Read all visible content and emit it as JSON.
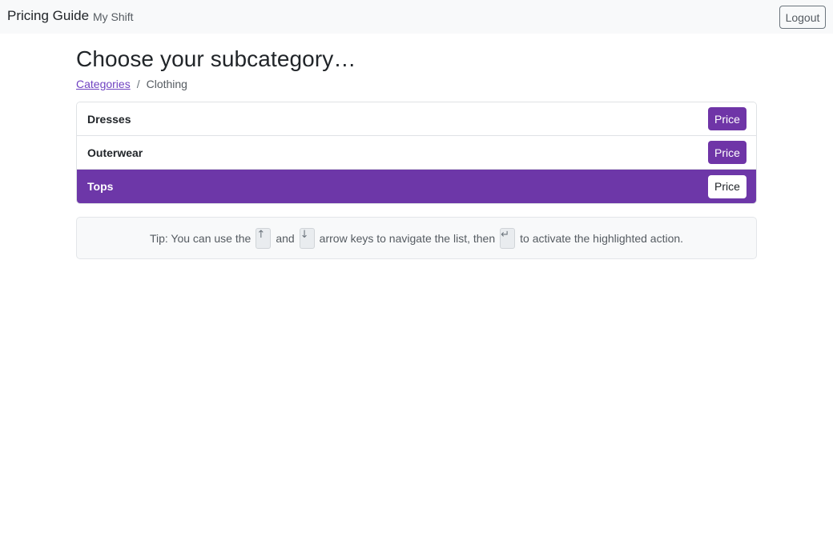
{
  "navbar": {
    "brand": "Pricing Guide",
    "links": [
      "My Shift"
    ],
    "logout_label": "Logout"
  },
  "page": {
    "title": "Choose your subcategory…"
  },
  "breadcrumb": {
    "parent": "Categories",
    "separator": "/",
    "current": "Clothing"
  },
  "subcategories": [
    {
      "label": "Dresses",
      "action": "Price",
      "active": false
    },
    {
      "label": "Outerwear",
      "action": "Price",
      "active": false
    },
    {
      "label": "Tops",
      "action": "Price",
      "active": true
    }
  ],
  "tip": {
    "part1": "Tip: You can use the",
    "key_up": "↑",
    "part2": "and",
    "key_down": "↓",
    "part3": "arrow keys to navigate the list, then",
    "key_enter": "↵",
    "part4": "to activate the highlighted action."
  },
  "colors": {
    "accent": "#6f35a7",
    "active_row": "#6d37a8",
    "link": "#6f42c1"
  }
}
